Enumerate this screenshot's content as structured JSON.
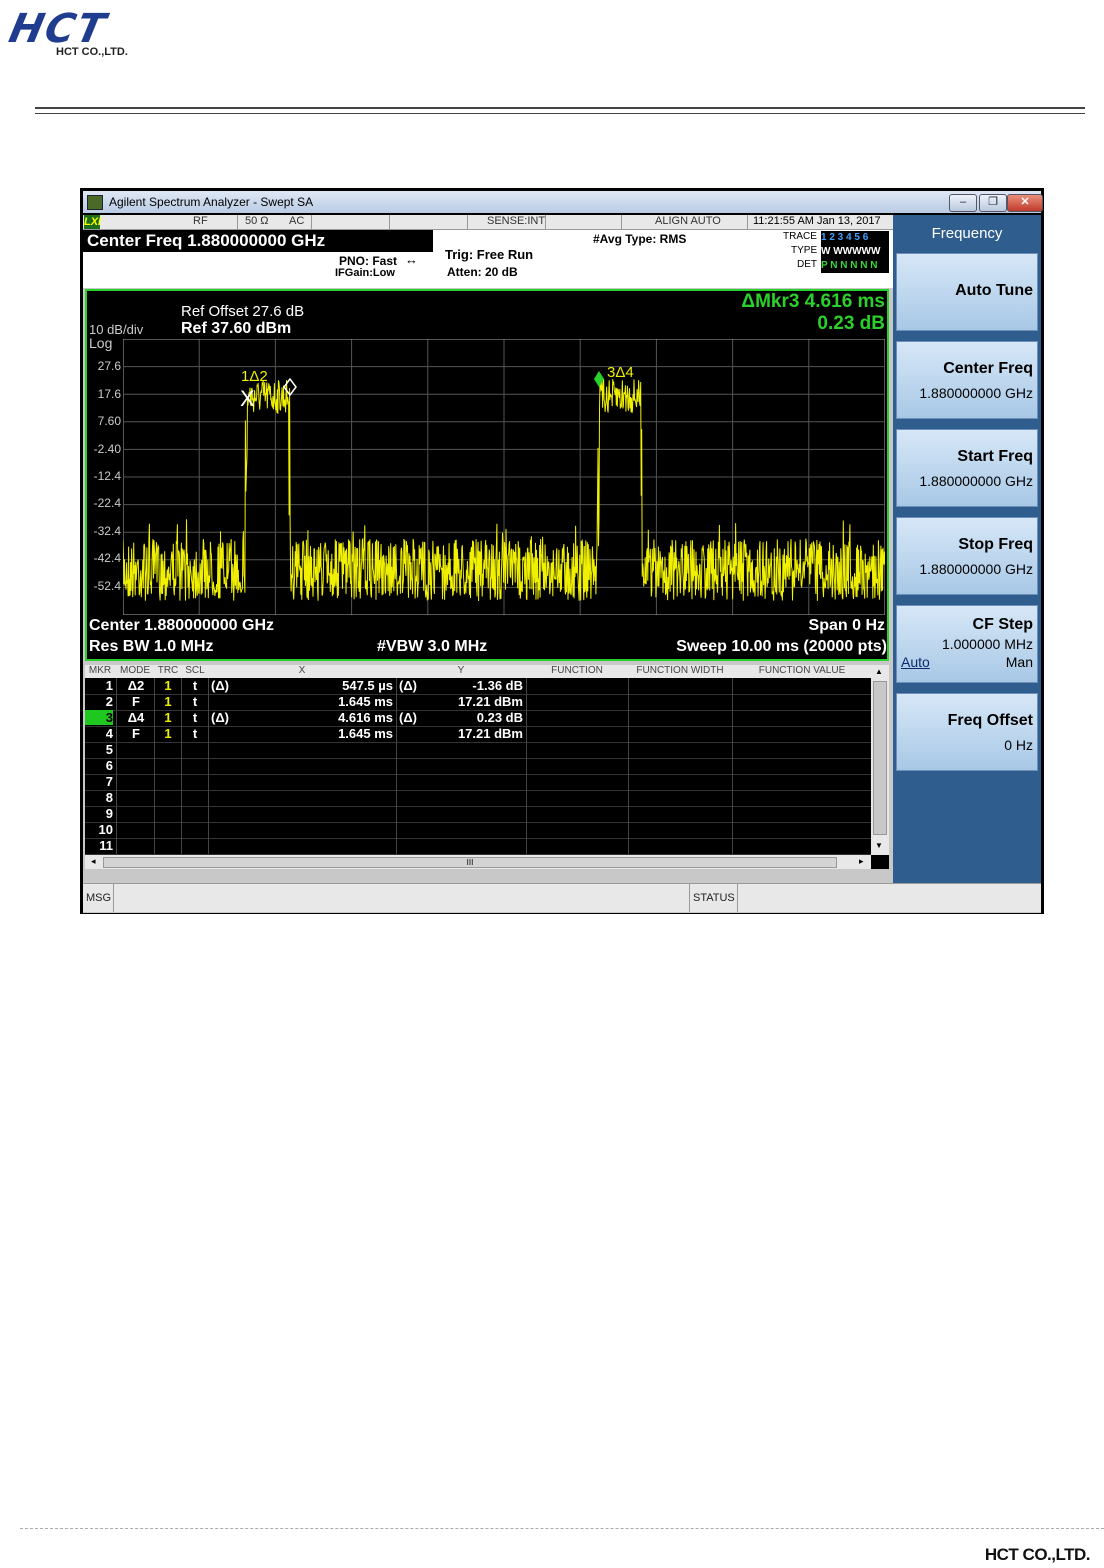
{
  "page": {
    "logo_text": "HCT",
    "logo_subtext": "HCT CO.,LTD.",
    "footer_brand": "HCT CO.,LTD."
  },
  "window": {
    "title": "Agilent Spectrum Analyzer - Swept SA",
    "controls": {
      "minimize": "–",
      "restore": "❐",
      "close": "✕"
    }
  },
  "status_row": {
    "badge": "LXI",
    "rf": "RF",
    "impedance": "50 Ω",
    "coupling": "AC",
    "sense": "SENSE:INT",
    "align": "ALIGN AUTO",
    "datetime": "11:21:55 AM Jan 13, 2017"
  },
  "info": {
    "center_freq": "Center Freq 1.880000000 GHz",
    "pno": "PNO: Fast",
    "ifgain": "IFGain:Low",
    "trig": "Trig: Free Run",
    "atten": "Atten: 20 dB",
    "avg_type": "#Avg Type: RMS",
    "trace_label": "TRACE",
    "type_label": "TYPE",
    "det_label": "DET",
    "trace_values": "1 2 3 4 5 6",
    "type_values": "W WWWWW",
    "det_values": "P N N N N N"
  },
  "graph": {
    "scale": "10 dB/div",
    "log": "Log",
    "ref_offset": "Ref Offset 27.6 dB",
    "ref_level": "Ref 37.60 dBm",
    "delta_marker": "ΔMkr3 4.616 ms",
    "delta_value": "0.23 dB",
    "y_ticks": [
      "27.6",
      "17.6",
      "7.60",
      "-2.40",
      "-12.4",
      "-22.4",
      "-32.4",
      "-42.4",
      "-52.4"
    ],
    "marker_labels": [
      "1Δ2",
      "3Δ4"
    ],
    "center": "Center 1.880000000 GHz",
    "span": "Span 0 Hz",
    "res_bw": "Res BW 1.0 MHz",
    "vbw": "#VBW 3.0 MHz",
    "sweep": "Sweep  10.00 ms (20000 pts)",
    "trace_color": "#f0f000",
    "frame_color": "#2bd12b"
  },
  "table": {
    "headers": [
      "MKR",
      "MODE",
      "TRC",
      "SCL",
      "X",
      "Y",
      "FUNCTION",
      "FUNCTION WIDTH",
      "FUNCTION VALUE"
    ],
    "rows": [
      {
        "mkr": "1",
        "mode": "Δ2",
        "trc": "1",
        "scl": "t",
        "xd": "(Δ)",
        "x": "547.5 µs",
        "yd": "(Δ)",
        "y": "-1.36 dB"
      },
      {
        "mkr": "2",
        "mode": "F",
        "trc": "1",
        "scl": "t",
        "xd": "",
        "x": "1.645 ms",
        "yd": "",
        "y": "17.21 dBm"
      },
      {
        "mkr": "3",
        "mode": "Δ4",
        "trc": "1",
        "scl": "t",
        "xd": "(Δ)",
        "x": "4.616 ms",
        "yd": "(Δ)",
        "y": "0.23 dB"
      },
      {
        "mkr": "4",
        "mode": "F",
        "trc": "1",
        "scl": "t",
        "xd": "",
        "x": "1.645 ms",
        "yd": "",
        "y": "17.21 dBm"
      },
      {
        "mkr": "5",
        "mode": "",
        "trc": "",
        "scl": "",
        "xd": "",
        "x": "",
        "yd": "",
        "y": ""
      },
      {
        "mkr": "6",
        "mode": "",
        "trc": "",
        "scl": "",
        "xd": "",
        "x": "",
        "yd": "",
        "y": ""
      },
      {
        "mkr": "7",
        "mode": "",
        "trc": "",
        "scl": "",
        "xd": "",
        "x": "",
        "yd": "",
        "y": ""
      },
      {
        "mkr": "8",
        "mode": "",
        "trc": "",
        "scl": "",
        "xd": "",
        "x": "",
        "yd": "",
        "y": ""
      },
      {
        "mkr": "9",
        "mode": "",
        "trc": "",
        "scl": "",
        "xd": "",
        "x": "",
        "yd": "",
        "y": ""
      },
      {
        "mkr": "10",
        "mode": "",
        "trc": "",
        "scl": "",
        "xd": "",
        "x": "",
        "yd": "",
        "y": ""
      },
      {
        "mkr": "11",
        "mode": "",
        "trc": "",
        "scl": "",
        "xd": "",
        "x": "",
        "yd": "",
        "y": ""
      }
    ],
    "scroll_thumb": "III",
    "selected_row": "3"
  },
  "softkeys": {
    "title": "Frequency",
    "auto_tune": "Auto Tune",
    "center_freq": "Center Freq",
    "center_freq_value": "1.880000000 GHz",
    "start_freq": "Start Freq",
    "start_freq_value": "1.880000000 GHz",
    "stop_freq": "Stop Freq",
    "stop_freq_value": "1.880000000 GHz",
    "cf_step": "CF Step",
    "cf_step_value": "1.000000 MHz",
    "cf_auto": "Auto",
    "cf_man": "Man",
    "freq_offset": "Freq Offset",
    "freq_offset_value": "0 Hz"
  },
  "msg_bar": {
    "msg": "MSG",
    "status": "STATUS"
  }
}
